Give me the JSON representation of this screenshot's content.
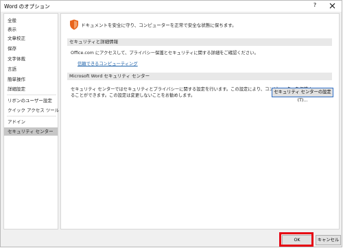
{
  "window": {
    "title": "Word のオプション",
    "help_label": "?"
  },
  "sidebar": {
    "items": [
      {
        "label": "全般"
      },
      {
        "label": "表示"
      },
      {
        "label": "文章校正"
      },
      {
        "label": "保存"
      },
      {
        "label": "文字体裁"
      },
      {
        "label": "言語"
      },
      {
        "label": "簡単操作"
      },
      {
        "label": "詳細設定"
      },
      {
        "label": "リボンのユーザー設定"
      },
      {
        "label": "クイック アクセス ツール バー"
      },
      {
        "label": "アドイン"
      },
      {
        "label": "セキュリティ センター",
        "selected": true
      }
    ]
  },
  "main": {
    "intro": "ドキュメントを安全に守り、コンピューターを正常で安全な状態に保ちます。",
    "privacy_section": {
      "heading": "セキュリティと詳細情報",
      "description": "Office.com にアクセスして、プライバシー保護とセキュリティに関する詳細をご確認ください。",
      "link": "信頼できるコンピューティング"
    },
    "trust_center_section": {
      "heading": "Microsoft Word セキュリティ センター",
      "description_line1": "セキュリティ センターではセキュリティとプライバシーに関する設定を行います。この設定により、コンピューターを保護す",
      "description_line2": "ることができます。この設定は変更しないことをお勧めします。",
      "settings_button": "セキュリティ センターの設定(T)..."
    }
  },
  "footer": {
    "ok_label": "OK",
    "cancel_label": "キャンセル"
  },
  "colors": {
    "highlight_border": "#e60012",
    "shield": "#e8641c",
    "link": "#1a5fa8",
    "selected_bg": "#c6c6c6"
  }
}
